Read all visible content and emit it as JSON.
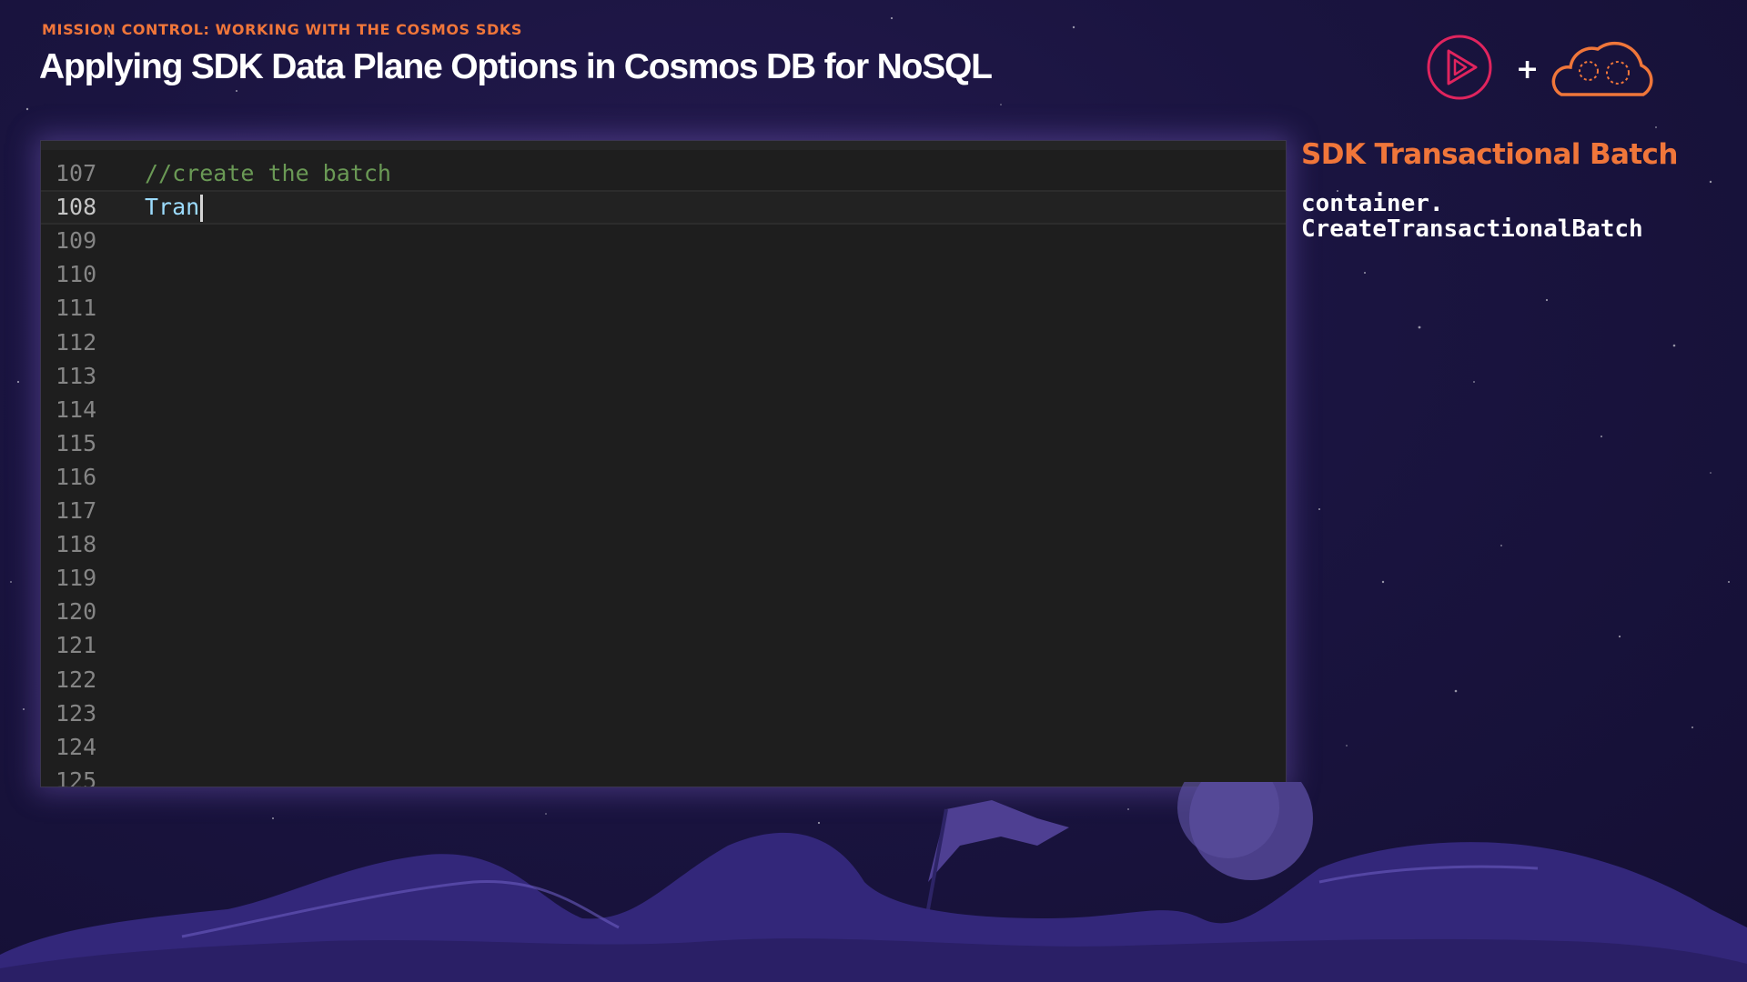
{
  "header": {
    "eyebrow": "MISSION CONTROL: WORKING WITH THE COSMOS SDKS",
    "title": "Applying SDK Data Plane Options in Cosmos DB for NoSQL",
    "plus": "+"
  },
  "editor": {
    "current_line": "108",
    "lines": [
      {
        "num": "107",
        "text": "//create the batch",
        "kind": "comment"
      },
      {
        "num": "108",
        "text": "Tran",
        "kind": "identifier"
      },
      {
        "num": "109",
        "text": ""
      },
      {
        "num": "110",
        "text": ""
      },
      {
        "num": "111",
        "text": ""
      },
      {
        "num": "112",
        "text": ""
      },
      {
        "num": "113",
        "text": ""
      },
      {
        "num": "114",
        "text": ""
      },
      {
        "num": "115",
        "text": ""
      },
      {
        "num": "116",
        "text": ""
      },
      {
        "num": "117",
        "text": ""
      },
      {
        "num": "118",
        "text": ""
      },
      {
        "num": "119",
        "text": ""
      },
      {
        "num": "120",
        "text": ""
      },
      {
        "num": "121",
        "text": ""
      },
      {
        "num": "122",
        "text": ""
      },
      {
        "num": "123",
        "text": ""
      },
      {
        "num": "124",
        "text": ""
      },
      {
        "num": "125",
        "text": ""
      }
    ]
  },
  "sidebar": {
    "heading": "SDK Transactional Batch",
    "code_line1": "container.",
    "code_line2": "CreateTransactionalBatch"
  },
  "colors": {
    "accent": "#f0763a",
    "play_logo": "#e0245e",
    "background": "#1a1440",
    "editor_bg": "#1e1e1e",
    "comment": "#6a9955",
    "identifier": "#9cdcfe"
  },
  "icons": {
    "brand_logo": "play-circle-icon",
    "cloud_logo": "cloud-icon"
  }
}
